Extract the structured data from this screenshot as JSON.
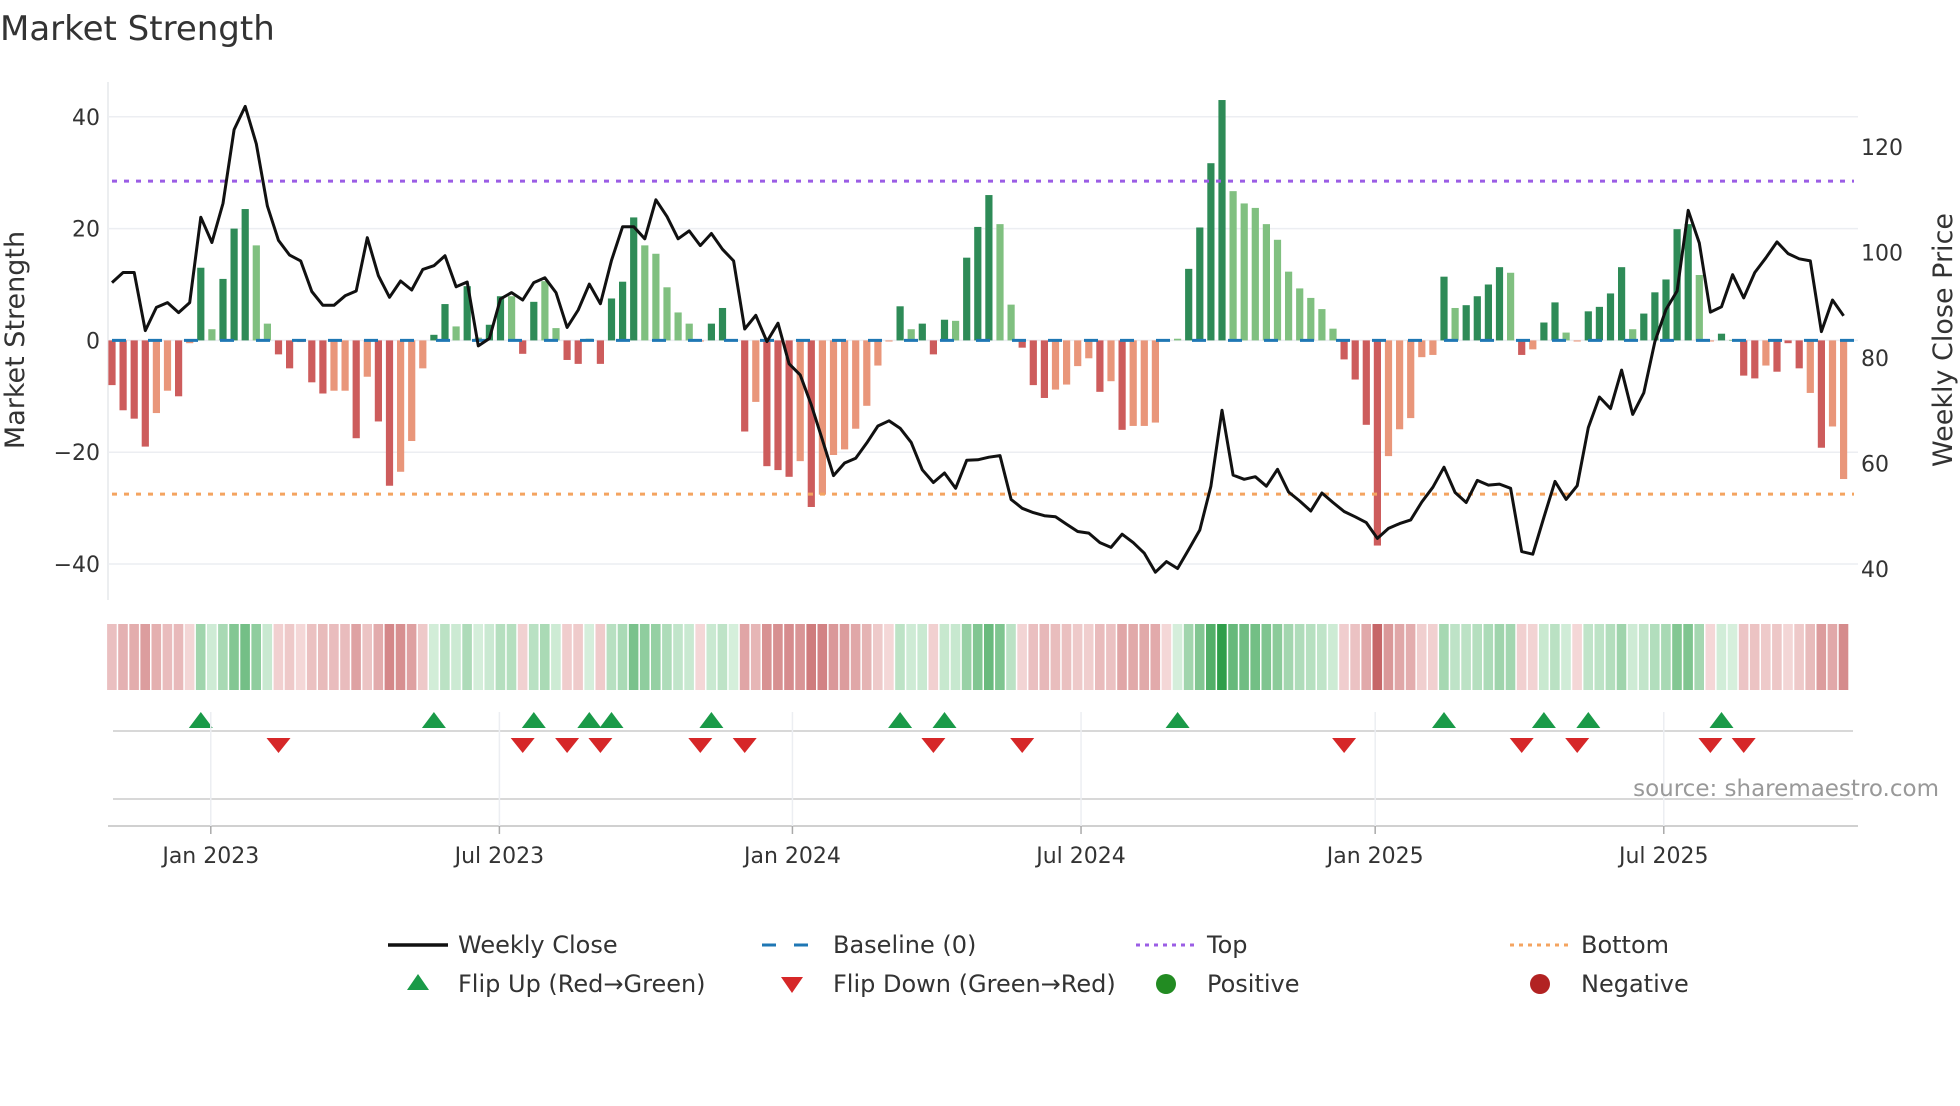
{
  "chart_data": {
    "type": "bar",
    "title": "Market Strength",
    "ylabel": "Market Strength",
    "y2label": "Weekly Close Price",
    "source": "source: sharemaestro.com",
    "frequency": "weekly",
    "ylim": [
      -46.5,
      46.3
    ],
    "y2lim": [
      34,
      132.4
    ],
    "yticks": [
      -40,
      -20,
      0,
      20,
      40
    ],
    "y2ticks": [
      40,
      60,
      80,
      100,
      120
    ],
    "ytick_labels": [
      "−40",
      "−20",
      "0",
      "20",
      "40"
    ],
    "y2tick_labels": [
      "40",
      "60",
      "80",
      "100",
      "120"
    ],
    "xticks": [
      {
        "label": "Jan 2023",
        "week": 8.9
      },
      {
        "label": "Jul 2023",
        "week": 34.9
      },
      {
        "label": "Jan 2024",
        "week": 61.3
      },
      {
        "label": "Jul 2024",
        "week": 87.3
      },
      {
        "label": "Jan 2025",
        "week": 113.8
      },
      {
        "label": "Jul 2025",
        "week": 139.8
      }
    ],
    "top_level": 28.5,
    "bottom_level": -27.5,
    "baseline": 0,
    "strength": [
      -8,
      -12.5,
      -14,
      -19,
      -13,
      -9,
      -10,
      -0.5,
      13,
      2,
      11,
      20,
      23.5,
      17,
      3,
      -2.5,
      -5,
      -0.3,
      -7.5,
      -9.5,
      -9,
      -9,
      -17.5,
      -6.5,
      -14.5,
      -26,
      -23.5,
      -18,
      -5,
      1,
      6.5,
      2.5,
      9.7,
      0.5,
      2.8,
      7.9,
      7.9,
      -2.4,
      6.9,
      10.6,
      2.2,
      -3.5,
      -4.2,
      0.3,
      -4.2,
      7.5,
      10.5,
      22,
      17,
      15.5,
      9.5,
      5,
      3,
      -0.2,
      3,
      5.8,
      0.2,
      -16.3,
      -11,
      -22.5,
      -23.2,
      -24.4,
      -21.6,
      -29.8,
      -27.6,
      -20.5,
      -19.5,
      -15.8,
      -11.7,
      -4.5,
      -0.2,
      6.1,
      2,
      3,
      -2.5,
      3.7,
      3.5,
      14.8,
      20.3,
      26,
      20.8,
      6.4,
      -1.3,
      -8,
      -10.3,
      -8.8,
      -7.9,
      -4.6,
      -3.2,
      -9.2,
      -7.3,
      -16,
      -15.3,
      -15.3,
      -14.7,
      -0.2,
      0.3,
      12.8,
      20.2,
      31.7,
      43,
      26.7,
      24.5,
      23.7,
      20.8,
      18,
      12.3,
      9.3,
      7.6,
      5.6,
      2.1,
      -3.4,
      -7,
      -15.1,
      -36.7,
      -20.7,
      -15.9,
      -13.9,
      -3,
      -2.6,
      11.4,
      5.8,
      6.3,
      7.9,
      10,
      13.1,
      12.1,
      -2.6,
      -1.6,
      3.2,
      6.8,
      1.4,
      -0.2,
      5.2,
      6,
      8.4,
      13.1,
      2,
      4.8,
      8.6,
      10.9,
      19.9,
      20.8,
      11.7,
      -0.2,
      1.2,
      0.1,
      -6.3,
      -6.8,
      -4.5,
      -5.6,
      -0.5,
      -5,
      -9.4,
      -19.2,
      -15.4,
      -24.8
    ],
    "shade": "DDDDLLDLDLDDDLLDDLDDLLDLDDLLLDDLDLDDLDDLLDDLDDDDLLLLLLDDLDLDDDLDLLLLLLLDLDDDLDDDLLDDDLLLLDLDLLLLLDDDDLLLLLLLLLLDDDDLLLLLDLDDDDLDLDDLLDDDDLDDDDDLLDLDDLDDDLD",
    "weekly_close": [
      94.3,
      96.2,
      96.2,
      85.2,
      89.6,
      90.5,
      88.6,
      90.5,
      106.7,
      101.9,
      109.3,
      123.3,
      127.7,
      120.6,
      108.8,
      102.3,
      99.5,
      98.4,
      92.6,
      90,
      90,
      91.8,
      92.7,
      102.8,
      95.6,
      91.5,
      94.6,
      92.9,
      96.8,
      97.5,
      99.4,
      93.5,
      94.4,
      82.3,
      83.7,
      91.2,
      92.4,
      91,
      94.3,
      95.2,
      92.4,
      85.8,
      89.1,
      94,
      90.3,
      98.5,
      104.9,
      104.9,
      102.6,
      110,
      106.8,
      102.6,
      104.1,
      101.3,
      103.6,
      100.6,
      98.4,
      85.5,
      88.1,
      83.1,
      86.6,
      78.9,
      76.8,
      71.1,
      64.5,
      57.7,
      60.1,
      61,
      63.9,
      67.1,
      68.1,
      66.7,
      64,
      58.8,
      56.4,
      58.2,
      55.3,
      60.6,
      60.7,
      61.2,
      61.5,
      53.2,
      51.5,
      50.7,
      50.1,
      49.9,
      48.5,
      47.1,
      46.8,
      45,
      44.1,
      46.6,
      45,
      43,
      39.4,
      41.4,
      40.1,
      43.7,
      47.4,
      55.7,
      70.1,
      57.8,
      57,
      57.5,
      55.7,
      58.9,
      54.6,
      52.9,
      51,
      54.4,
      52.6,
      50.9,
      49.9,
      48.8,
      45.8,
      47.7,
      48.6,
      49.3,
      52.7,
      55.5,
      59.3,
      54.5,
      52.6,
      56.8,
      55.9,
      56.1,
      55.3,
      43.3,
      42.8,
      49.8,
      56.6,
      53.2,
      55.8,
      66.8,
      72.6,
      70.4,
      77.7,
      69.3,
      73.4,
      83.1,
      89.2,
      92.7,
      108,
      101.8,
      88.7,
      89.7,
      95.8,
      91.4,
      96.2,
      99,
      102,
      99.8,
      98.8,
      98.4,
      85,
      91,
      88
    ],
    "flip_up_weeks": [
      8,
      29,
      38,
      43,
      45,
      54,
      71,
      75,
      96,
      120,
      129,
      133,
      145
    ],
    "flip_down_weeks": [
      15,
      37,
      41,
      44,
      53,
      57,
      74,
      82,
      111,
      127,
      132,
      144,
      147
    ],
    "legend": [
      {
        "key": "close",
        "label": "Weekly Close"
      },
      {
        "key": "baseline",
        "label": "Baseline (0)"
      },
      {
        "key": "top",
        "label": "Top"
      },
      {
        "key": "bottom",
        "label": "Bottom"
      },
      {
        "key": "flipup",
        "label": "Flip Up (Red→Green)"
      },
      {
        "key": "flipdown",
        "label": "Flip Down (Green→Red)"
      },
      {
        "key": "positive",
        "label": "Positive"
      },
      {
        "key": "negative",
        "label": "Negative"
      }
    ],
    "legend_placement": "bottom",
    "colors": {
      "pos_dark": "#2e8b57",
      "pos_light": "#80c080",
      "neg_dark": "#cd5c5c",
      "neg_light": "#e9967a",
      "line": "#111111",
      "baseline": "#1f77b4",
      "top": "#9b5de5",
      "bottom": "#f4a460",
      "flip_up": "#1a9a48",
      "flip_down": "#d62728",
      "positive": "#228b22",
      "negative": "#b22222"
    }
  }
}
